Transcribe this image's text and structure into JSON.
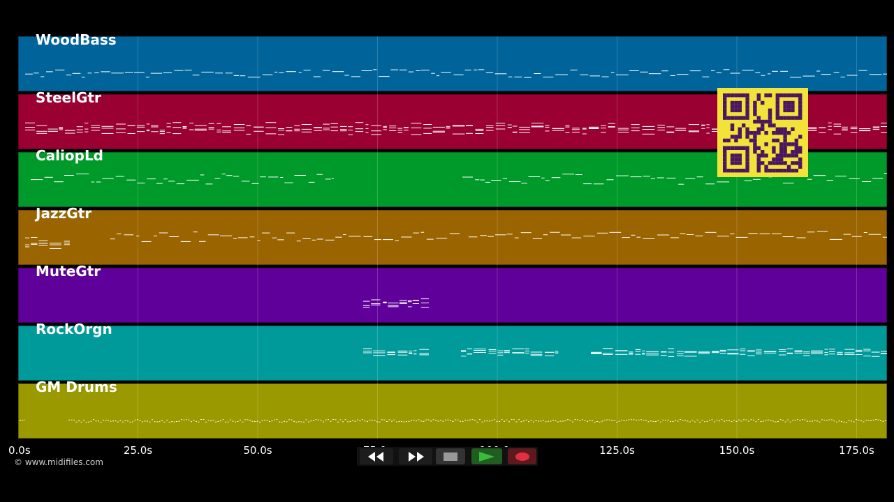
{
  "tracks": [
    {
      "name": "WoodBass",
      "color": "#00649a"
    },
    {
      "name": "SteelGtr",
      "color": "#9a0031"
    },
    {
      "name": "CaliopLd",
      "color": "#009a2a"
    },
    {
      "name": "JazzGtr",
      "color": "#9a6400"
    },
    {
      "name": "MuteGtr",
      "color": "#60009a"
    },
    {
      "name": "RockOrgn",
      "color": "#009a9a"
    },
    {
      "name": "GM Drums",
      "color": "#9a9a00"
    }
  ],
  "timeline": {
    "ticks": [
      "0.0s",
      "25.0s",
      "50.0s",
      "75.0s",
      "100.0s",
      "125.0s",
      "150.0s",
      "175.0s"
    ]
  },
  "footer": {
    "credit": "© www.midifiles.com"
  },
  "transport": {
    "buttons": [
      {
        "name": "rewind",
        "icon": "rewind-icon"
      },
      {
        "name": "fast-forward",
        "icon": "fast-forward-icon"
      },
      {
        "name": "stop",
        "icon": "stop-icon"
      },
      {
        "name": "play",
        "icon": "play-icon"
      },
      {
        "name": "record",
        "icon": "record-icon"
      }
    ]
  },
  "colors": {
    "note": "#ffffff",
    "qr_fg": "#4a1660",
    "qr_bg": "#f2e23a",
    "play": "#3cba3c",
    "record": "#e03040"
  }
}
